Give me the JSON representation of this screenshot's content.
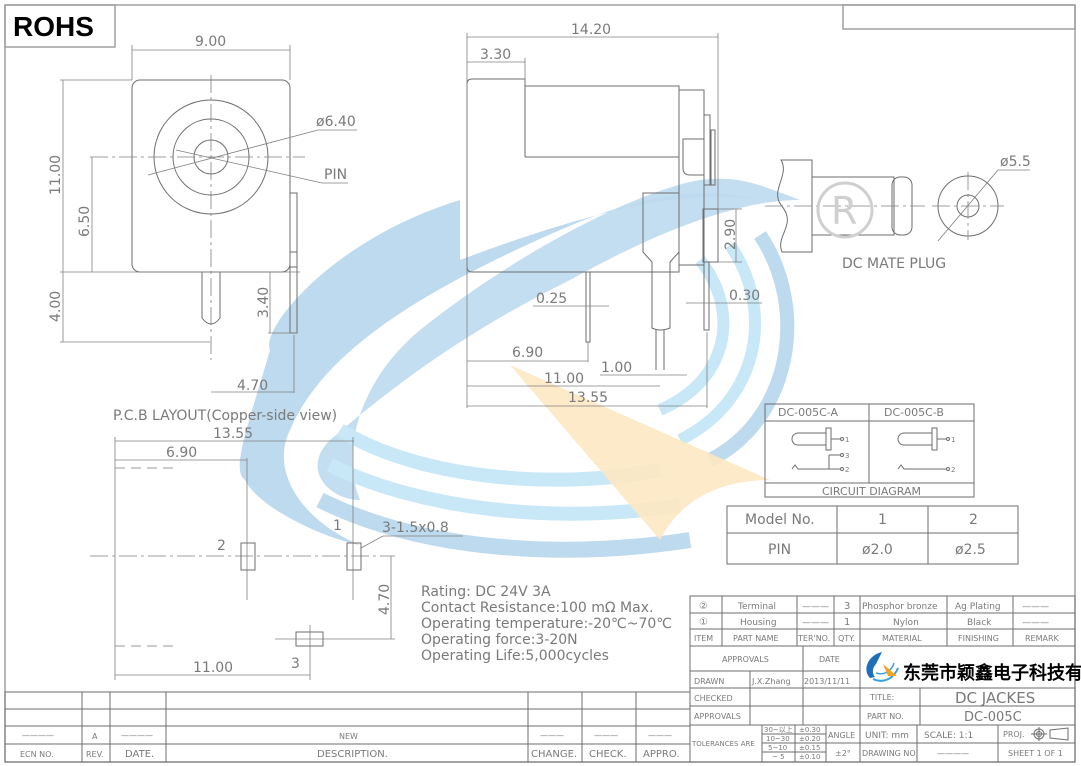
{
  "badge": "ROHS",
  "front_view": {
    "width": "9.00",
    "height": "11.00",
    "center_height": "6.50",
    "pin_length": "4.00",
    "tab_length": "3.40",
    "tab_offset": "4.70",
    "diameter": "ø6.40",
    "pin_label": "PIN"
  },
  "side_view": {
    "overall_length": "14.20",
    "front_step": "3.30",
    "tab_height": "2.90",
    "pin_thickness": "0.25",
    "tab_thickness": "0.30",
    "pin_width": "1.00",
    "pin2_pos": "6.90",
    "pin3_pos": "11.00",
    "pin1_pos": "13.55"
  },
  "mate_plug": {
    "label": "DC  MATE  PLUG",
    "diameter": "ø5.5",
    "registered_mark": "R"
  },
  "pcb_layout": {
    "title": "P.C.B  LAYOUT(Copper-side  view)",
    "overall": "13.55",
    "pin2_pos": "6.90",
    "pin3_pos": "11.00",
    "pin3_offset": "4.70",
    "pad_spec": "3-1.5x0.8",
    "pins": [
      "1",
      "2",
      "3"
    ]
  },
  "specs": [
    "Rating:  DC  24V   3A",
    "Contact  Resistance:100  mΩ  Max.",
    "Operating  temperature:-20℃~70℃",
    "Operating  force:3-20N",
    "Operating  Life:5,000cycles"
  ],
  "circuit_diagram": {
    "title": "CIRCUIT  DIAGRAM",
    "variants": [
      "DC-005C-A",
      "DC-005C-B"
    ],
    "pin_labels": [
      "1",
      "2",
      "3"
    ]
  },
  "model_table": {
    "headers": [
      "Model  No.",
      "1",
      "2"
    ],
    "row": [
      "PIN",
      "ø2.0",
      "ø2.5"
    ]
  },
  "bom": {
    "rows": [
      {
        "item": "②",
        "part_name": "Terminal",
        "ter_no": "———",
        "qty": "3",
        "material": "Phosphor bronze",
        "finishing": "Ag Plating",
        "remark": "———"
      },
      {
        "item": "①",
        "part_name": "Housing",
        "ter_no": "———",
        "qty": "1",
        "material": "Nylon",
        "finishing": "Black",
        "remark": "———"
      }
    ],
    "headers": {
      "item": "ITEM",
      "part_name": "PART NAME",
      "ter_no": "TER'NO.",
      "qty": "QTY.",
      "material": "MATERIAL",
      "finishing": "FINISHING",
      "remark": "REMARK"
    }
  },
  "title_block": {
    "approvals_header": "APPROVALS",
    "date_header": "DATE",
    "drawn_label": "DRAWN",
    "drawn_by": "J.X.Zhang",
    "drawn_date": "2013/11/11",
    "checked_label": "CHECKED",
    "approvals_label": "APPROVALS",
    "company": "东莞市颖鑫电子科技有限公司",
    "title_label": "TITLE:",
    "title": "DC  JACKES",
    "part_no_label": "PART NO.",
    "part_no": "DC-005C",
    "tolerances_label": "TOLERANCES  ARE",
    "tolerances": [
      {
        "range": "30~以上",
        "value": "±0.30"
      },
      {
        "range": "10~30",
        "value": "±0.20"
      },
      {
        "range": "5~10",
        "value": "±0.15"
      },
      {
        "range": "~ 5",
        "value": "±0.10"
      }
    ],
    "angle_label": "ANGLE",
    "angle_value": "±2°",
    "unit": "UNIT:  mm",
    "scale": "SCALE:   1:1",
    "proj": "PROJ.",
    "drawing_no_label": "DRAWING NO.",
    "drawing_no": "————",
    "sheet": "SHEET   1  OF  1"
  },
  "revision_block": {
    "row": {
      "ecn": "————",
      "rev": "A",
      "date": "————",
      "description": "NEW",
      "change": "———",
      "check": "———",
      "appro": "———"
    },
    "headers": {
      "ecn": "ECN  NO.",
      "rev": "REV.",
      "date": "DATE.",
      "description": "DESCRIPTION.",
      "change": "CHANGE.",
      "check": "CHECK.",
      "appro": "APPRO."
    }
  },
  "watermark_colors": {
    "blue": "#b3d4ec",
    "light_blue": "#bfe4f7",
    "orange": "#fde3b8"
  }
}
